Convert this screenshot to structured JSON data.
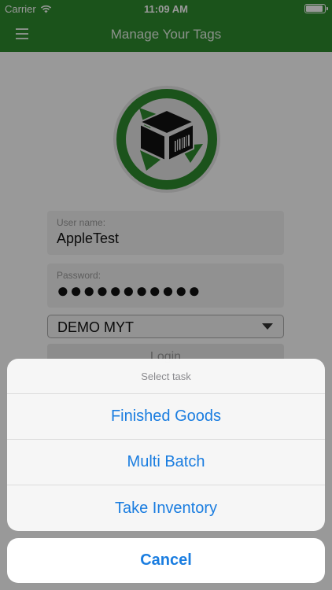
{
  "status": {
    "carrier": "Carrier",
    "time": "11:09 AM",
    "battery_level": 0.9
  },
  "nav": {
    "title": "Manage Your Tags",
    "menu_icon": "hamburger-menu-icon"
  },
  "logo": {
    "icon": "package-box-logo-icon"
  },
  "form": {
    "username_label": "User name:",
    "username_value": "AppleTest",
    "password_label": "Password:",
    "password_value": "●●●●●●●●●●●",
    "company_value": "DEMO MYT",
    "login_label": "Login"
  },
  "action_sheet": {
    "title": "Select task",
    "items": [
      {
        "label": "Finished Goods"
      },
      {
        "label": "Multi Batch"
      },
      {
        "label": "Take Inventory"
      }
    ],
    "cancel_label": "Cancel"
  },
  "colors": {
    "header_green": "#2e8b2e",
    "action_blue": "#1a7de0"
  }
}
